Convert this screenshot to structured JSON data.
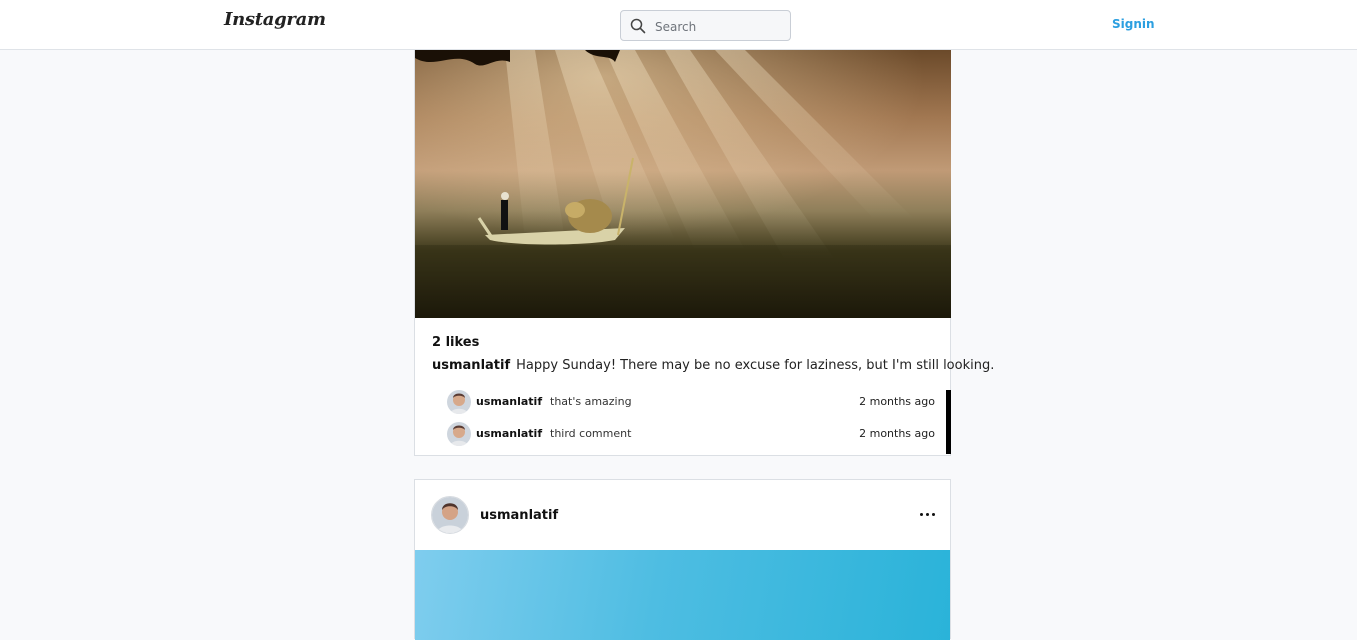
{
  "header": {
    "logo": "Instagram",
    "search_placeholder": "Search",
    "signin_label": "Signin"
  },
  "posts": [
    {
      "likes": "2 likes",
      "caption_user": "usmanlatif",
      "caption_text": "Happy Sunday! There may be no excuse for laziness, but I'm still looking.",
      "comments": [
        {
          "user": "usmanlatif",
          "text": "that's amazing",
          "time": "2 months ago"
        },
        {
          "user": "usmanlatif",
          "text": "third comment",
          "time": "2 months ago"
        }
      ]
    },
    {
      "user": "usmanlatif",
      "more_icon": "ellipsis-icon"
    }
  ],
  "colors": {
    "accent": "#2c9fe0",
    "background": "#f8f9fb"
  }
}
